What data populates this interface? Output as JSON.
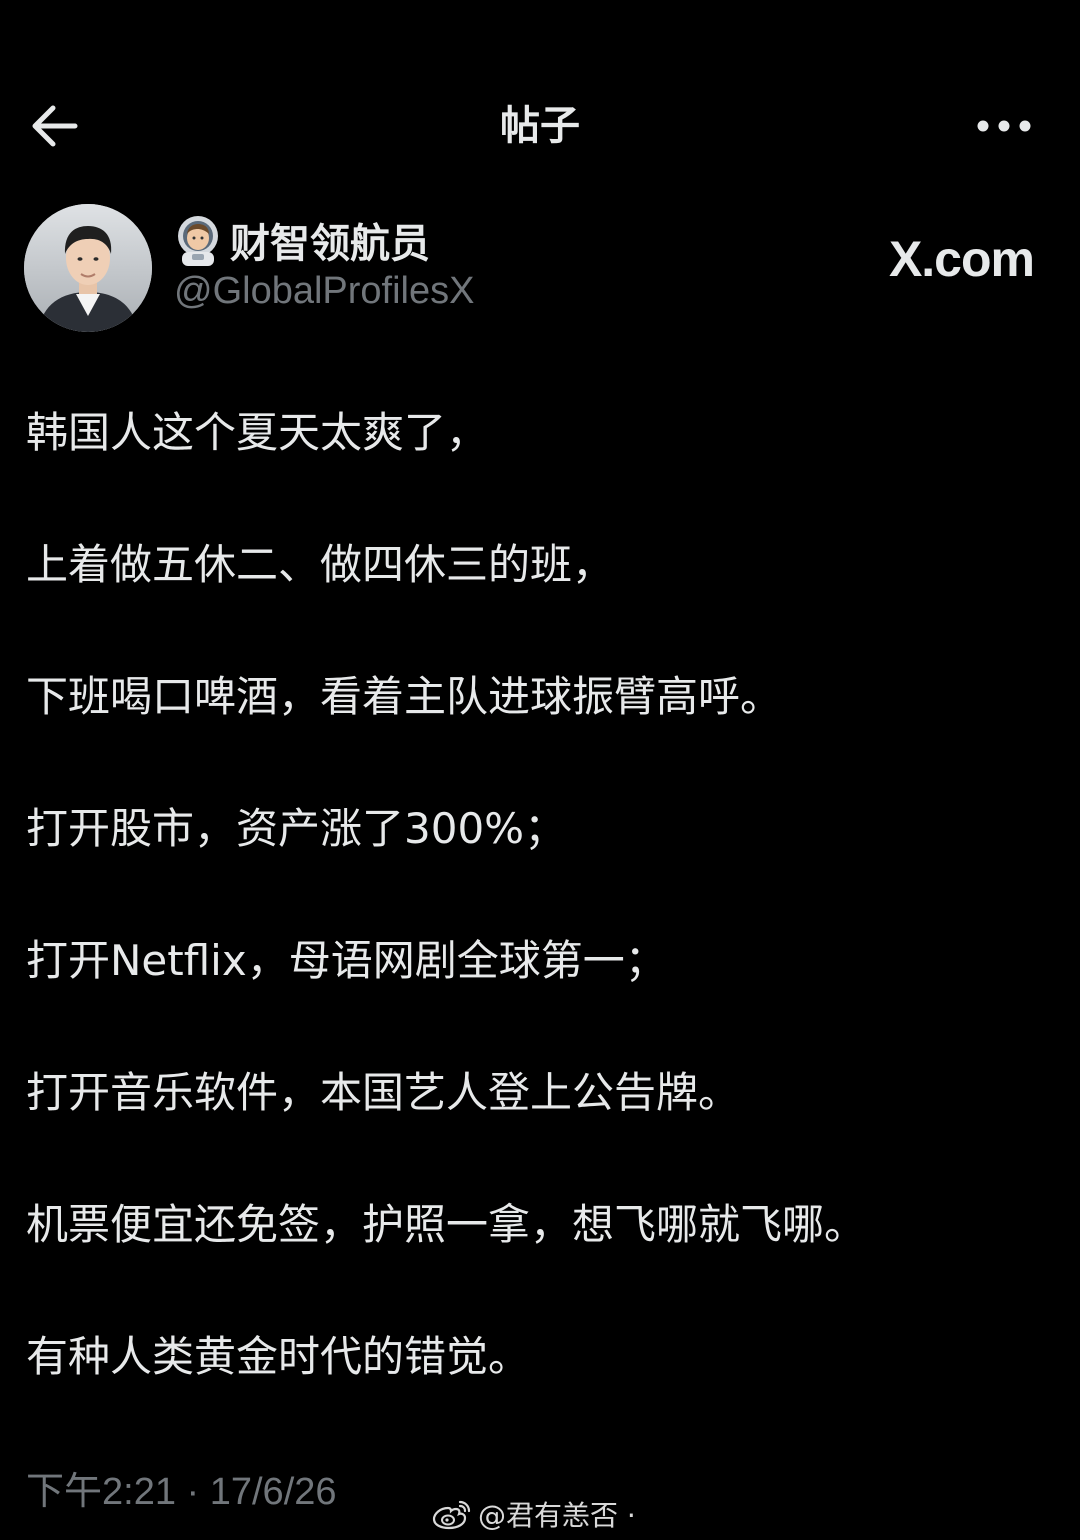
{
  "header": {
    "title": "帖子",
    "back_icon": "arrow-left-icon",
    "more_icon": "more-horizontal-icon"
  },
  "author": {
    "emoji_icon": "astronaut-emoji-icon",
    "display_name": "财智领航员",
    "handle": "@GlobalProfilesX",
    "source": "X.com"
  },
  "post": {
    "lines": [
      "韩国人这个夏天太爽了，",
      "上着做五休二、做四休三的班，",
      "下班喝口啤酒，看着主队进球振臂高呼。",
      "打开股市，资产涨了300%；",
      "打开Netflix，母语网剧全球第一；",
      "打开音乐软件，本国艺人登上公告牌。",
      "机票便宜还免签，护照一拿，想飞哪就飞哪。",
      "有种人类黄金时代的错觉。"
    ],
    "timestamp": "下午2:21 · 17/6/26"
  },
  "watermark": {
    "icon": "weibo-logo-icon",
    "text": "@君有恙否 ·"
  },
  "colors": {
    "background": "#000000",
    "primary_text": "#e7e9ea",
    "secondary_text": "#71767b"
  }
}
